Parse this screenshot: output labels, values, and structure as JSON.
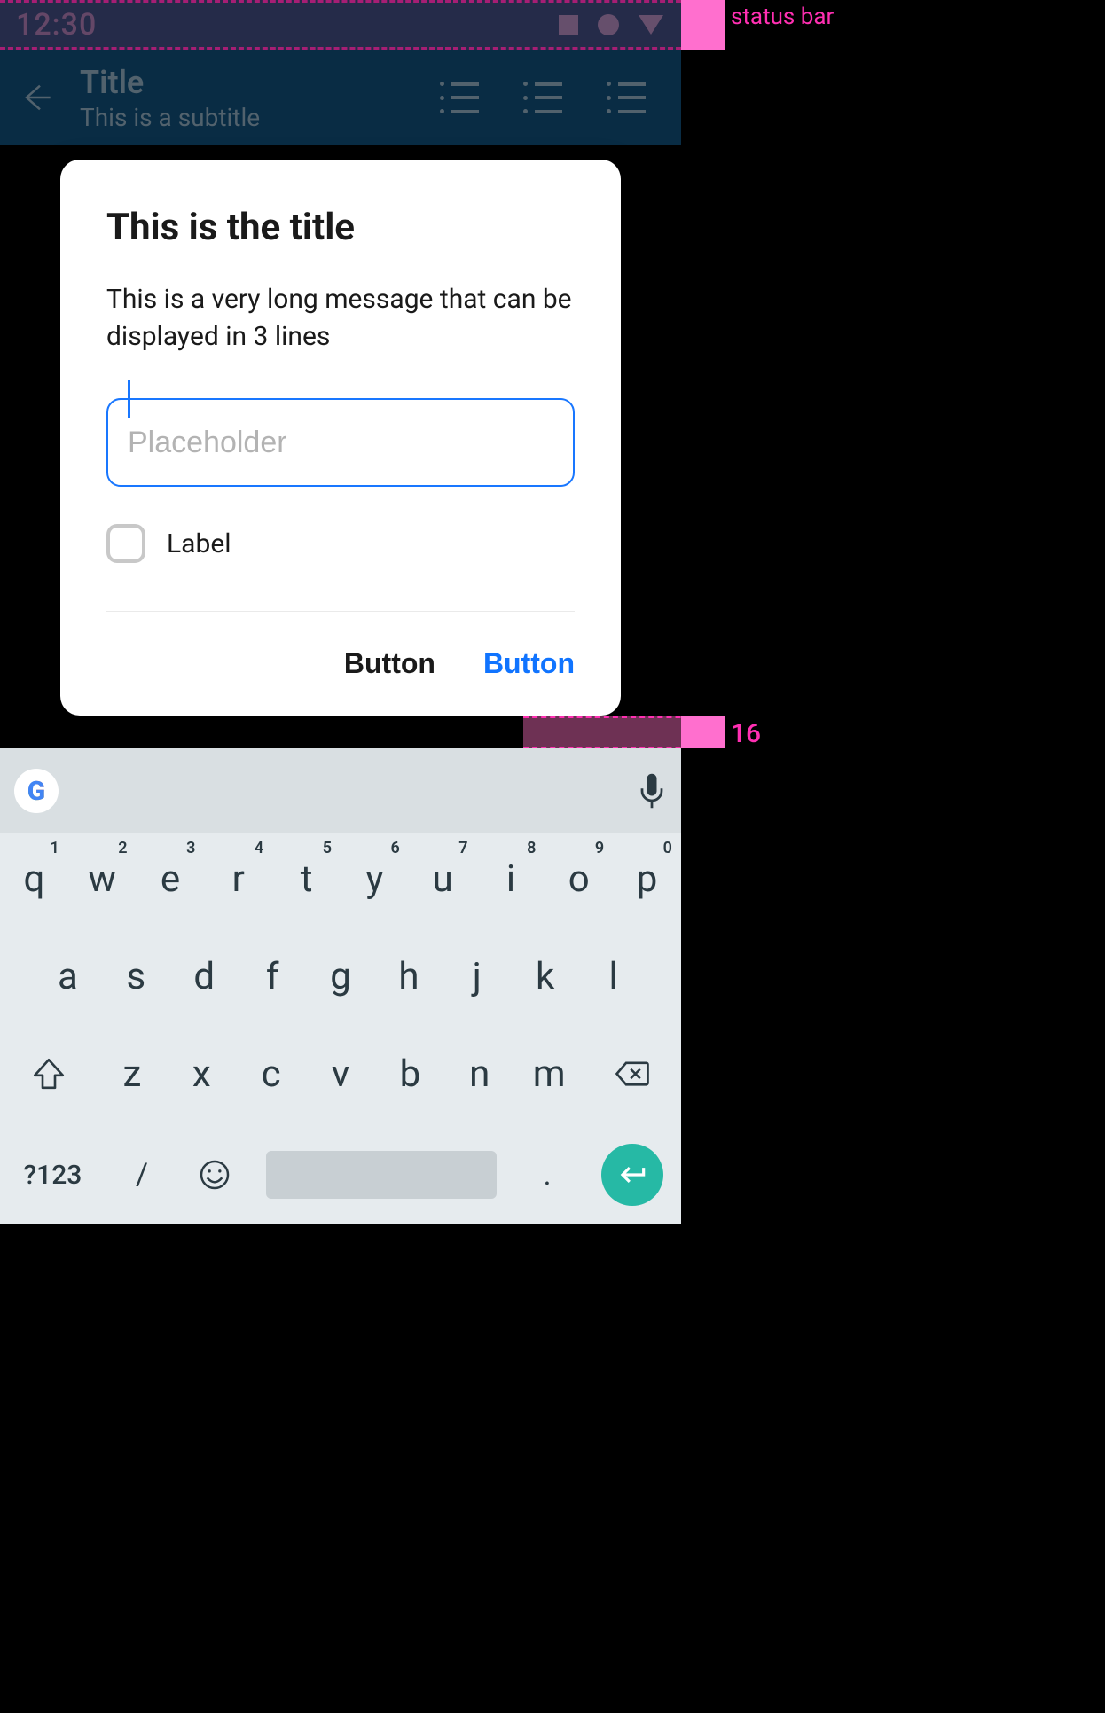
{
  "annotations": {
    "status_label": "status bar",
    "spacing_label": "16"
  },
  "status": {
    "time": "12:30"
  },
  "appbar": {
    "title": "Title",
    "subtitle": "This is a subtitle"
  },
  "dialog": {
    "title": "This is the title",
    "message": "This is a very long message that can be displayed in 3 lines",
    "input_placeholder": "Placeholder",
    "input_value": "",
    "checkbox_label": "Label",
    "checkbox_checked": false,
    "secondary_button": "Button",
    "primary_button": "Button"
  },
  "keyboard": {
    "row1": [
      {
        "k": "q",
        "n": "1"
      },
      {
        "k": "w",
        "n": "2"
      },
      {
        "k": "e",
        "n": "3"
      },
      {
        "k": "r",
        "n": "4"
      },
      {
        "k": "t",
        "n": "5"
      },
      {
        "k": "y",
        "n": "6"
      },
      {
        "k": "u",
        "n": "7"
      },
      {
        "k": "i",
        "n": "8"
      },
      {
        "k": "o",
        "n": "9"
      },
      {
        "k": "p",
        "n": "0"
      }
    ],
    "row2": [
      "a",
      "s",
      "d",
      "f",
      "g",
      "h",
      "j",
      "k",
      "l"
    ],
    "row3": [
      "z",
      "x",
      "c",
      "v",
      "b",
      "n",
      "m"
    ],
    "symbols_key": "?123",
    "slash_key": "/",
    "period_key": "."
  }
}
